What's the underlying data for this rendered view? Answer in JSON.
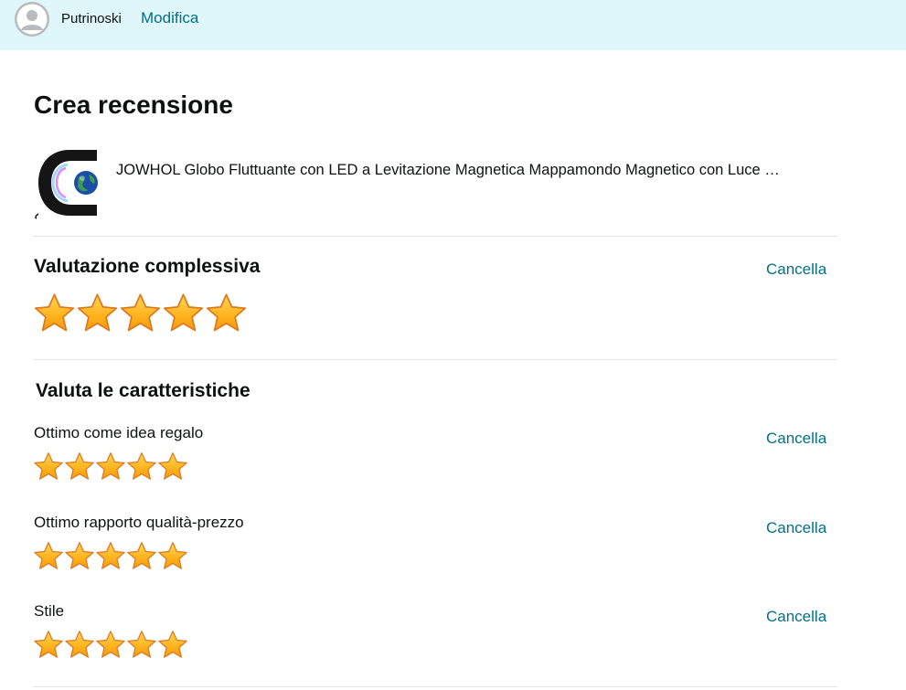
{
  "header": {
    "username": "Putrinoski",
    "edit_label": "Modifica",
    "icon": "user-avatar-icon",
    "background": "#dff6fb"
  },
  "page": {
    "title": "Crea recensione"
  },
  "product": {
    "title": "JOWHOL Globo Fluttuante con LED a Levitazione Magnetica Mappamondo Magnetico con Luce …",
    "image_icon": "floating-globe-icon"
  },
  "overall": {
    "title": "Valutazione complessiva",
    "clear_label": "Cancella",
    "rating": 5,
    "max": 5
  },
  "features": {
    "title": "Valuta le caratteristiche",
    "items": [
      {
        "label": "Ottimo come idea regalo",
        "clear_label": "Cancella",
        "rating": 5,
        "max": 5
      },
      {
        "label": "Ottimo rapporto qualità-prezzo",
        "clear_label": "Cancella",
        "rating": 5,
        "max": 5
      },
      {
        "label": "Stile",
        "clear_label": "Cancella",
        "rating": 5,
        "max": 5
      }
    ]
  },
  "colors": {
    "link": "#007185",
    "star_fill": "#ffa41c",
    "star_outline": "#de7921",
    "divider": "#e3e6e6"
  }
}
